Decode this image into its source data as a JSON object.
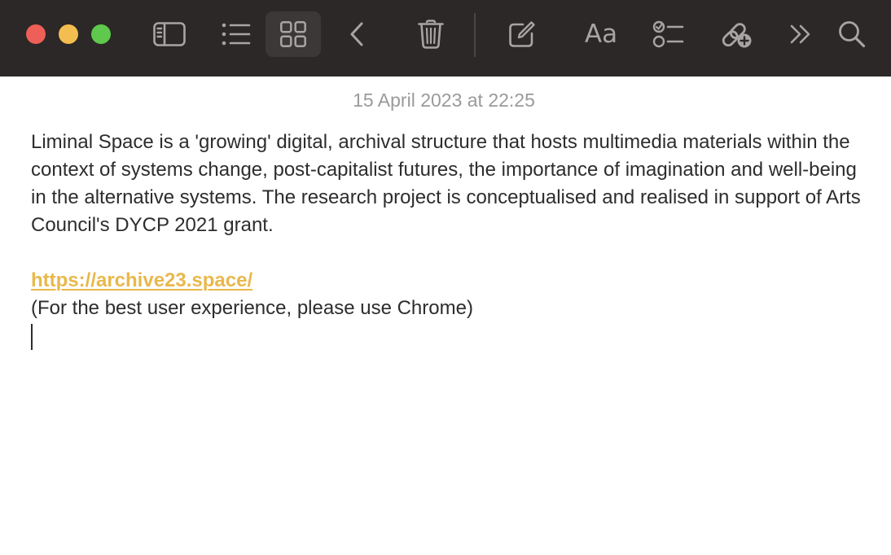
{
  "window": {
    "traffic_lights": {
      "close_color": "#ee5f57",
      "minimize_color": "#f4bd4f",
      "zoom_color": "#5ec94c"
    }
  },
  "toolbar": {
    "icon_color": "#a7a5a3",
    "active_background": "#3b3837",
    "active_view": "gallery",
    "buttons": [
      {
        "name": "sidebar-toggle-button",
        "icon": "sidebar-icon"
      },
      {
        "name": "list-view-button",
        "icon": "list-icon"
      },
      {
        "name": "gallery-view-button",
        "icon": "grid-icon",
        "active": true
      },
      {
        "name": "back-button",
        "icon": "chevron-left-icon"
      },
      {
        "name": "delete-button",
        "icon": "trash-icon"
      },
      {
        "name": "compose-button",
        "icon": "compose-icon"
      },
      {
        "name": "format-button",
        "icon": "format-text-icon",
        "label": "Aa"
      },
      {
        "name": "checklist-button",
        "icon": "checklist-icon"
      },
      {
        "name": "collaborate-button",
        "icon": "link-add-icon"
      },
      {
        "name": "more-button",
        "icon": "chevron-double-right-icon"
      },
      {
        "name": "search-button",
        "icon": "search-icon"
      }
    ]
  },
  "note": {
    "date": "15 April 2023 at 22:25",
    "paragraph": "Liminal Space is a 'growing' digital, archival structure that hosts multimedia materials within the context of systems change, post-capitalist futures, the importance of imagination and well-being in the alternative systems. The research project is conceptualised and realised in support of Arts Council's DYCP 2021 grant.",
    "link_text": "https://archive23.space/",
    "link_color": "#e9b84b",
    "browser_note": "(For the best user experience, please use Chrome)"
  }
}
